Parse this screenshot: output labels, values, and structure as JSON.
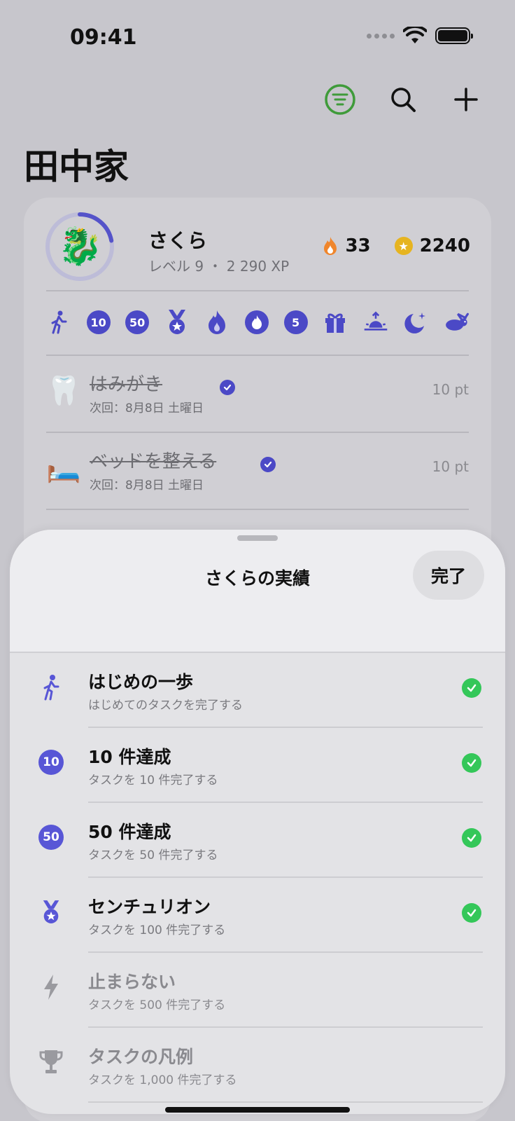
{
  "status_bar": {
    "time": "09:41"
  },
  "page": {
    "title": "田中家"
  },
  "profile": {
    "avatar": "🐉",
    "name": "さくら",
    "level_text": "レベル 9 ・ 2 290 XP",
    "streak": "33",
    "coins": "2240",
    "progress": 0.22
  },
  "badges": [
    {
      "icon": "walk-icon"
    },
    {
      "number": "10"
    },
    {
      "number": "50"
    },
    {
      "icon": "medal-icon"
    },
    {
      "icon": "flame-icon"
    },
    {
      "icon": "flame-circle-icon"
    },
    {
      "number": "5"
    },
    {
      "icon": "gift-icon"
    },
    {
      "icon": "sunrise-icon"
    },
    {
      "icon": "moon-stars-icon"
    },
    {
      "icon": "hare-icon"
    }
  ],
  "tasks": [
    {
      "emoji": "🦷",
      "name": "はみがき",
      "next": "次回：8月8日 土曜日",
      "points": "10 pt"
    },
    {
      "emoji": "🛏️",
      "name": "ベッドを整える",
      "next": "次回：8月8日 土曜日",
      "points": "10 pt"
    }
  ],
  "sheet": {
    "title": "さくらの実績",
    "done_label": "完了",
    "achievements": [
      {
        "icon": "walk-icon",
        "title": "はじめの一歩",
        "desc": "はじめてのタスクを完了する",
        "unlocked": true
      },
      {
        "number": "10",
        "title": "10 件達成",
        "desc": "タスクを 10 件完了する",
        "unlocked": true
      },
      {
        "number": "50",
        "title": "50 件達成",
        "desc": "タスクを 50 件完了する",
        "unlocked": true
      },
      {
        "icon": "medal-icon",
        "title": "センチュリオン",
        "desc": "タスクを 100 件完了する",
        "unlocked": true
      },
      {
        "icon": "bolt-icon",
        "title": "止まらない",
        "desc": "タスクを 500 件完了する",
        "unlocked": false
      },
      {
        "icon": "trophy-icon",
        "title": "タスクの凡例",
        "desc": "タスクを 1,000 件完了する",
        "unlocked": false
      }
    ]
  },
  "colors": {
    "accent": "#5856d6",
    "success": "#34c759",
    "coin": "#e6b420",
    "flame": "#f0862c"
  }
}
